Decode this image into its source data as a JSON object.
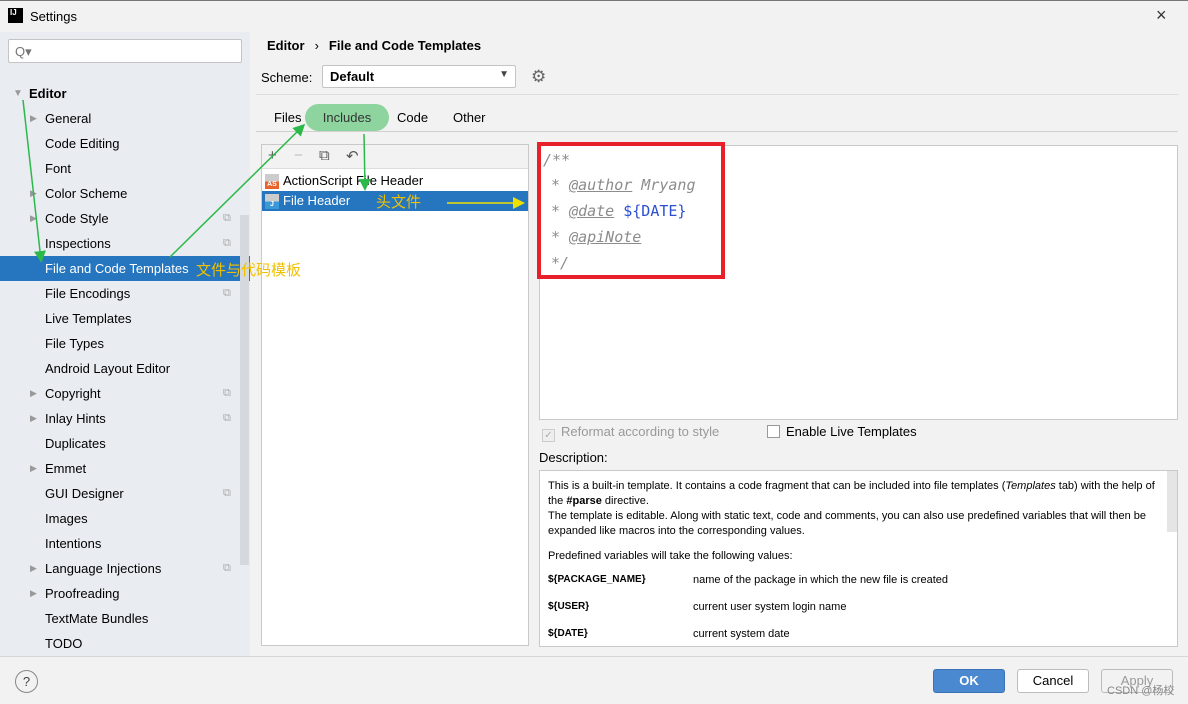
{
  "window": {
    "title": "Settings",
    "icon": "intellij-icon",
    "close": "×"
  },
  "sidebar": {
    "search_placeholder": "Q▾",
    "items": [
      {
        "label": "Editor",
        "expanded": true
      },
      {
        "label": "General",
        "arrow": true
      },
      {
        "label": "Code Editing"
      },
      {
        "label": "Font"
      },
      {
        "label": "Color Scheme",
        "arrow": true
      },
      {
        "label": "Code Style",
        "arrow": true,
        "copy": true
      },
      {
        "label": "Inspections",
        "copy": true
      },
      {
        "label": "File and Code Templates",
        "selected": true
      },
      {
        "label": "File Encodings",
        "copy": true
      },
      {
        "label": "Live Templates"
      },
      {
        "label": "File Types"
      },
      {
        "label": "Android Layout Editor"
      },
      {
        "label": "Copyright",
        "arrow": true,
        "copy": true
      },
      {
        "label": "Inlay Hints",
        "arrow": true,
        "copy": true
      },
      {
        "label": "Duplicates"
      },
      {
        "label": "Emmet",
        "arrow": true
      },
      {
        "label": "GUI Designer",
        "copy": true
      },
      {
        "label": "Images"
      },
      {
        "label": "Intentions"
      },
      {
        "label": "Language Injections",
        "arrow": true,
        "copy": true
      },
      {
        "label": "Proofreading",
        "arrow": true
      },
      {
        "label": "TextMate Bundles"
      },
      {
        "label": "TODO"
      }
    ]
  },
  "breadcrumb": {
    "parent": "Editor",
    "sep": "›",
    "current": "File and Code Templates"
  },
  "scheme": {
    "label": "Scheme:",
    "value": "Default"
  },
  "tabs": [
    "Files",
    "Includes",
    "Code",
    "Other"
  ],
  "active_tab": "Includes",
  "toolbar": {
    "add": "+",
    "remove": "−",
    "copy": "⧉",
    "reset": "↶"
  },
  "templates": [
    {
      "name": "ActionScript File Header",
      "icon": "AS"
    },
    {
      "name": "File Header",
      "icon": "J",
      "selected": true
    }
  ],
  "editor": {
    "lines": [
      "/**",
      "* ",
      "@author",
      " Mryang",
      "@date",
      " ${DATE}",
      "@apiNote",
      "*/"
    ]
  },
  "options": {
    "reformat": "Reformat according to style",
    "reformat_checked": true,
    "live": "Enable Live Templates",
    "live_checked": false
  },
  "description": {
    "label": "Description:",
    "p1a": "This is a built-in template. It contains a code fragment that can be included into file templates (",
    "p1i": "Templates",
    "p1b": " tab) with the help of the ",
    "p1c": "#parse",
    "p1d": " directive.",
    "p2": "The template is editable. Along with static text, code and comments, you can also use predefined variables that will then be expanded like macros into the corresponding values.",
    "p3": "Predefined variables will take the following values:",
    "vars": [
      {
        "name": "${PACKAGE_NAME}",
        "desc": "name of the package in which the new file is created"
      },
      {
        "name": "${USER}",
        "desc": "current user system login name"
      },
      {
        "name": "${DATE}",
        "desc": "current system date"
      }
    ]
  },
  "buttons": {
    "help": "?",
    "ok": "OK",
    "cancel": "Cancel",
    "apply": "Apply"
  },
  "annotations": {
    "templates": "文件与代码模板",
    "header": "头文件"
  },
  "watermark": "CSDN @杨校",
  "colors": {
    "selection": "#2675bf",
    "highlight": "#8dd49e",
    "red_box": "#e8202a",
    "arrow_green": "#2db84a",
    "arrow_yellow": "#f0e000"
  }
}
